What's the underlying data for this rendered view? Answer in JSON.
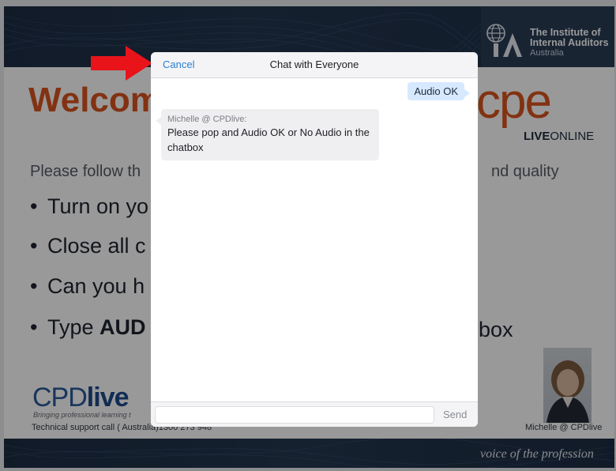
{
  "slide": {
    "header": {
      "org_line1": "The Institute of",
      "org_line2": "Internal Auditors",
      "org_line3": "Australia"
    },
    "welcome": "Welcom",
    "cpe_logo": "cpe",
    "live_online_bold": "LIVE",
    "live_online_rest": "ONLINE",
    "follow_text": "Please follow th",
    "follow_tail": "nd quality",
    "bullets": [
      "Turn on yo",
      "Close all c",
      "Can you h",
      "Type AUD"
    ],
    "bullet4_tail": "box",
    "brand_cpd": "CPD",
    "brand_live": "live",
    "tagline": "Bringing professional learning t",
    "support": "Technical support call ( Australia)1300 273 948",
    "presenter_name": "Michelle @ CPDlive",
    "footer_voice": "voice of the profession"
  },
  "dialog": {
    "cancel_label": "Cancel",
    "title": "Chat with Everyone",
    "messages": [
      {
        "from": "me",
        "text": "Audio OK"
      },
      {
        "from": "Michelle @ CPDlive:",
        "text": "Please pop and Audio OK or No Audio in the chatbox"
      }
    ],
    "input_value": "",
    "input_placeholder": "",
    "send_label": "Send"
  },
  "colors": {
    "accent_orange": "#d9541e",
    "navy": "#1d2d44",
    "link_blue": "#2a7fd4",
    "my_bubble": "#d6e9ff",
    "arrow_red": "#e8141a"
  }
}
